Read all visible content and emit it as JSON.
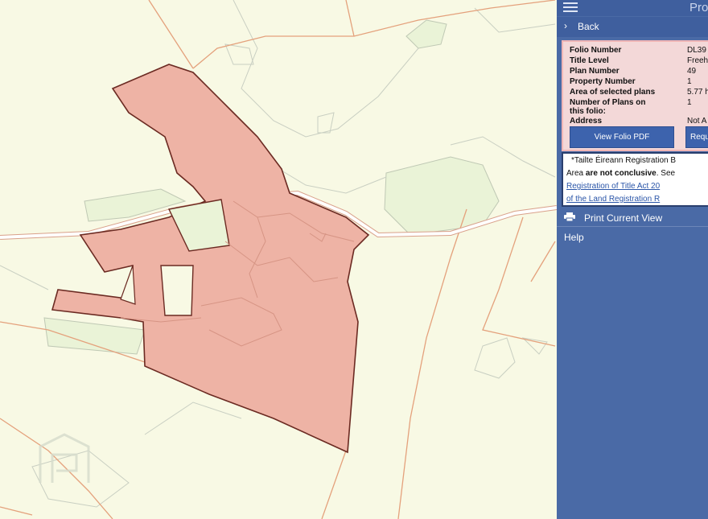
{
  "map": {
    "parcel_fill": "#eeb3a5",
    "parcel_stroke": "#6b2a22",
    "boundary_color": "#e5a27f",
    "road_color": "#ffffff",
    "field_color": "#eff5dc",
    "watermark_icon": "property-watermark-icon"
  },
  "panel": {
    "title": "Pro",
    "menu_icon": "hamburger-icon",
    "back_label": "Back",
    "folio": {
      "rows": [
        {
          "label": "Folio Number",
          "value": "DL39"
        },
        {
          "label": "Title Level",
          "value": "Freeh"
        },
        {
          "label": "Plan Number",
          "value": "49"
        },
        {
          "label": "Property Number",
          "value": "1"
        },
        {
          "label": "Area of selected plans",
          "value": "5.77 h"
        },
        {
          "label": "Number of Plans on this folio:",
          "value": "1"
        },
        {
          "label": "Address",
          "value": "Not A"
        }
      ],
      "view_pdf_label": "View Folio PDF",
      "request_label": "Requ"
    },
    "notice": {
      "line1": "*Tailte Éireann Registration B",
      "line2_pre": "Area ",
      "line2_bold": "are not conclusive",
      "line2_post": ". See",
      "link1": "Registration of Title Act 20",
      "link2": "of the Land Registration R"
    },
    "print_label": "Print Current View",
    "help_label": "Help",
    "accent": "#4a6aa6"
  }
}
